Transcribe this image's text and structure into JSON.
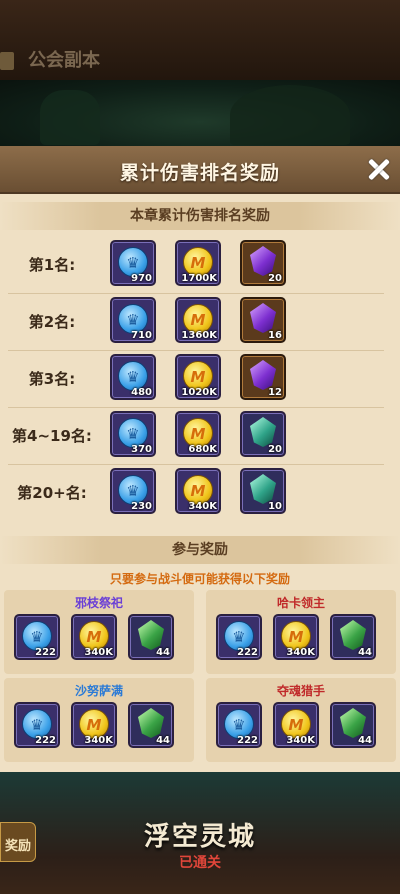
{
  "topbar": {
    "title": "公会副本"
  },
  "modal": {
    "title": "累计伤害排名奖励",
    "ranking_section": "本章累计伤害排名奖励",
    "ranks": [
      {
        "label": "第1名:",
        "rewards": [
          {
            "type": "blue-coin",
            "count": "970"
          },
          {
            "type": "gold-coin",
            "count": "1700K"
          },
          {
            "type": "purple-gem",
            "count": "20"
          }
        ]
      },
      {
        "label": "第2名:",
        "rewards": [
          {
            "type": "blue-coin",
            "count": "710"
          },
          {
            "type": "gold-coin",
            "count": "1360K"
          },
          {
            "type": "purple-gem",
            "count": "16"
          }
        ]
      },
      {
        "label": "第3名:",
        "rewards": [
          {
            "type": "blue-coin",
            "count": "480"
          },
          {
            "type": "gold-coin",
            "count": "1020K"
          },
          {
            "type": "purple-gem",
            "count": "12"
          }
        ]
      },
      {
        "label": "第4~19名:",
        "rewards": [
          {
            "type": "blue-coin",
            "count": "370"
          },
          {
            "type": "gold-coin",
            "count": "680K"
          },
          {
            "type": "teal-gem",
            "count": "20"
          }
        ]
      },
      {
        "label": "第20+名:",
        "rewards": [
          {
            "type": "blue-coin",
            "count": "230"
          },
          {
            "type": "gold-coin",
            "count": "340K"
          },
          {
            "type": "teal-gem",
            "count": "10"
          }
        ]
      }
    ],
    "participation_section": "参与奖励",
    "participation_note": "只要参与战斗便可能获得以下奖励",
    "bosses": [
      {
        "name": "邪枝祭祀",
        "color": "#6a3fd6",
        "rewards": [
          "222",
          "340K",
          "44"
        ]
      },
      {
        "name": "哈卡领主",
        "color": "#c02a2a",
        "rewards": [
          "222",
          "340K",
          "44"
        ]
      },
      {
        "name": "沙努萨满",
        "color": "#2a7ad6",
        "rewards": [
          "222",
          "340K",
          "44"
        ]
      },
      {
        "name": "夺魂猎手",
        "color": "#c02a2a",
        "rewards": [
          "222",
          "340K",
          "44"
        ]
      }
    ]
  },
  "bottom": {
    "side_button": "奖励",
    "zone_name": "浮空灵城",
    "zone_status": "已通关"
  },
  "colors": {
    "modal_bg": "#efe0c4",
    "header_bg": "#7a5c3e",
    "note": "#d46a10"
  }
}
